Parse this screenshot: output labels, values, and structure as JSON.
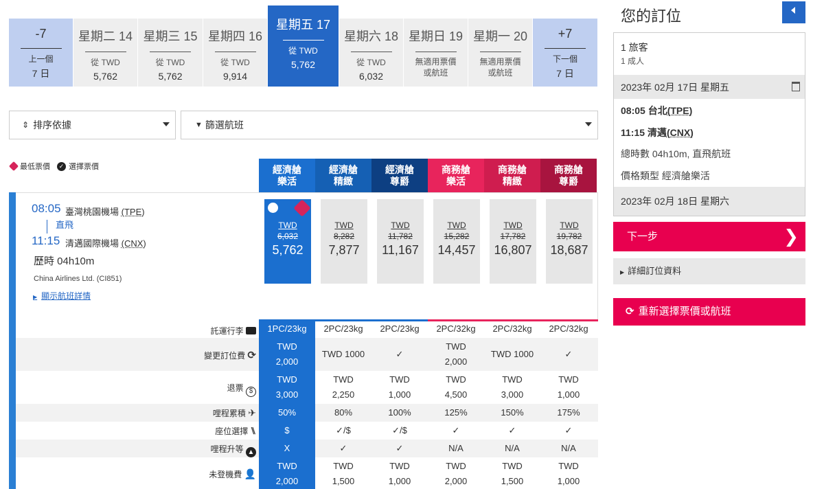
{
  "date_strip": {
    "prev": {
      "top": "-7",
      "sub": "上一個",
      "sub2": "7 日"
    },
    "days": [
      {
        "day": "星期二 14",
        "from": "從 TWD",
        "price": "5,762"
      },
      {
        "day": "星期三 15",
        "from": "從 TWD",
        "price": "5,762"
      },
      {
        "day": "星期四 16",
        "from": "從 TWD",
        "price": "9,914"
      },
      {
        "day": "星期五 17",
        "from": "從 TWD",
        "price": "5,762"
      },
      {
        "day": "星期六 18",
        "from": "從 TWD",
        "price": "6,032"
      },
      {
        "day": "星期日 19",
        "none1": "無適用票價",
        "none2": "或航班"
      },
      {
        "day": "星期一 20",
        "none1": "無適用票價",
        "none2": "或航班"
      }
    ],
    "next": {
      "top": "+7",
      "sub": "下一個",
      "sub2": "7 日"
    }
  },
  "toolbar": {
    "sort_label": "排序依據",
    "filter_label": "篩選航班"
  },
  "legend": {
    "lowest": "最低票價",
    "selected": "選擇票價"
  },
  "fare_headers": [
    {
      "line1": "經濟艙",
      "line2": "樂活",
      "color": "#1b6fcf"
    },
    {
      "line1": "經濟艙",
      "line2": "精緻",
      "color": "#1560b4"
    },
    {
      "line1": "經濟艙",
      "line2": "尊爵",
      "color": "#0d3f82"
    },
    {
      "line1": "商務艙",
      "line2": "樂活",
      "color": "#e8245c"
    },
    {
      "line1": "商務艙",
      "line2": "精緻",
      "color": "#cf1d4f"
    },
    {
      "line1": "商務艙",
      "line2": "尊爵",
      "color": "#a8143f"
    }
  ],
  "flight": {
    "dep_time": "08:05",
    "dep_airport": "臺灣桃園機場",
    "dep_code": "(TPE)",
    "direct": "直飛",
    "arr_time": "11:15",
    "arr_airport": "清邁國際機場",
    "arr_code": "(CNX)",
    "duration": "歷時 04h10m",
    "carrier": "China Airlines Ltd. (CI851)",
    "details_link": "顯示航班詳情"
  },
  "prices": [
    {
      "cur": "TWD",
      "old": "6,032",
      "new": "5,762"
    },
    {
      "cur": "TWD",
      "old": "8,282",
      "new": "7,877"
    },
    {
      "cur": "TWD",
      "old": "11,782",
      "new": "11,167"
    },
    {
      "cur": "TWD",
      "old": "15,282",
      "new": "14,457"
    },
    {
      "cur": "TWD",
      "old": "17,782",
      "new": "16,807"
    },
    {
      "cur": "TWD",
      "old": "19,782",
      "new": "18,687"
    }
  ],
  "details": {
    "baggage": {
      "label": "託運行李",
      "values": [
        "1PC/23kg",
        "2PC/23kg",
        "2PC/23kg",
        "2PC/32kg",
        "2PC/32kg",
        "2PC/32kg"
      ]
    },
    "change": {
      "label": "變更訂位費",
      "values": [
        [
          "TWD",
          "2,000"
        ],
        [
          "TWD 1000"
        ],
        [
          "✓"
        ],
        [
          "TWD",
          "2,000"
        ],
        [
          "TWD 1000"
        ],
        [
          "✓"
        ]
      ]
    },
    "refund": {
      "label": "退票",
      "values": [
        [
          "TWD",
          "3,000"
        ],
        [
          "TWD",
          "2,250"
        ],
        [
          "TWD",
          "1,000"
        ],
        [
          "TWD",
          "4,500"
        ],
        [
          "TWD",
          "3,000"
        ],
        [
          "TWD",
          "1,000"
        ]
      ]
    },
    "miles": {
      "label": "哩程累積",
      "values": [
        "50%",
        "80%",
        "100%",
        "125%",
        "150%",
        "175%"
      ]
    },
    "seat": {
      "label": "座位選擇",
      "values": [
        "$",
        "✓/$",
        "✓/$",
        "✓",
        "✓",
        "✓"
      ]
    },
    "upgrade": {
      "label": "哩程升等",
      "values": [
        "X",
        "✓",
        "✓",
        "N/A",
        "N/A",
        "N/A"
      ]
    },
    "noshow": {
      "label": "未登機費",
      "values": [
        [
          "TWD",
          "2,000"
        ],
        [
          "TWD",
          "1,500"
        ],
        [
          "TWD",
          "1,000"
        ],
        [
          "TWD",
          "2,000"
        ],
        [
          "TWD",
          "1,500"
        ],
        [
          "TWD",
          "1,000"
        ]
      ]
    }
  },
  "booking": {
    "title": "您的訂位",
    "pax": "1 旅客",
    "adult": "1 成人",
    "date": "2023年 02月 17日 星期五",
    "dep": "08:05 台北",
    "dep_code": "(TPE)",
    "arr": "11:15 清邁",
    "arr_code": "(CNX)",
    "total": "總時數 04h10m, 直飛航班",
    "fare_type": "價格類型 經濟艙樂活",
    "date2": "2023年 02月 18日 星期六",
    "next": "下一步",
    "details": "詳細訂位資料",
    "reselect": "重新選擇票價或航班"
  }
}
